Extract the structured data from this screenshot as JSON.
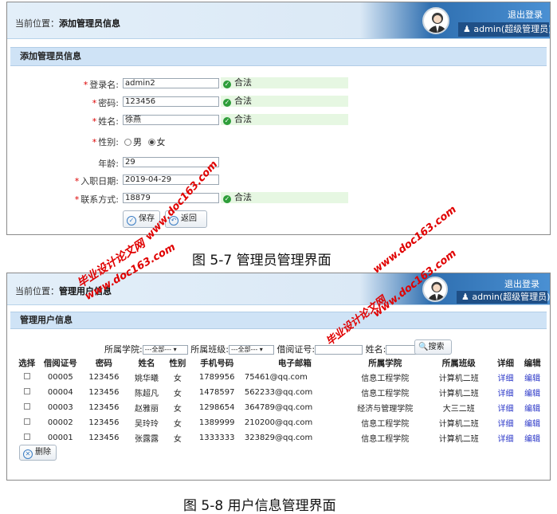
{
  "figure1": {
    "breadcrumb_prefix": "当前位置：",
    "breadcrumb_current": "添加管理员信息",
    "logout": "退出登录",
    "admin_label": "admin(超级管理员)",
    "section_title": "添加管理员信息",
    "fields": [
      {
        "label": "登录名:",
        "required": true,
        "value": "admin2",
        "status": "合法"
      },
      {
        "label": "密码:",
        "required": true,
        "value": "123456",
        "status": "合法"
      },
      {
        "label": "姓名:",
        "required": true,
        "value": "徐燕",
        "status": "合法"
      },
      {
        "label": "年龄:",
        "required": false,
        "value": "29",
        "status": ""
      },
      {
        "label": "入职日期:",
        "required": true,
        "value": "2019-04-29",
        "status": ""
      },
      {
        "label": "联系方式:",
        "required": true,
        "value": "18879",
        "status": "合法"
      }
    ],
    "gender": {
      "label": "性别:",
      "options": [
        "男",
        "女"
      ],
      "selected": "女"
    },
    "save_btn": "保存",
    "back_btn": "返回",
    "caption": "图 5-7 管理员管理界面"
  },
  "figure2": {
    "breadcrumb_prefix": "当前位置：",
    "breadcrumb_current": "管理用户信息",
    "logout": "退出登录",
    "admin_label": "admin(超级管理员)",
    "section_title": "管理用户信息",
    "filters": {
      "college_label": "所属学院:",
      "college_value": "---全部---",
      "class_label": "所属班级:",
      "class_value": "---全部---",
      "card_label": "借阅证号:",
      "name_label": "姓名:",
      "search_btn": "搜索"
    },
    "columns": [
      "选择",
      "借阅证号",
      "密码",
      "姓名",
      "性别",
      "手机号码",
      "电子邮箱",
      "所属学院",
      "所属班级",
      "详细",
      "编辑"
    ],
    "rows": [
      {
        "id": "00005",
        "pwd": "123456",
        "name": "姚华曦",
        "sex": "女",
        "phone": "1789956",
        "email": "75461@qq.com",
        "college": "信息工程学院",
        "cls": "计算机二班",
        "detail": "详细",
        "edit": "编辑"
      },
      {
        "id": "00004",
        "pwd": "123456",
        "name": "陈超凡",
        "sex": "女",
        "phone": "1478597",
        "email": "562233@qq.com",
        "college": "信息工程学院",
        "cls": "计算机二班",
        "detail": "详细",
        "edit": "编辑"
      },
      {
        "id": "00003",
        "pwd": "123456",
        "name": "赵雅丽",
        "sex": "女",
        "phone": "1298654",
        "email": "364789@qq.com",
        "college": "经济与管理学院",
        "cls": "大三二班",
        "detail": "详细",
        "edit": "编辑"
      },
      {
        "id": "00002",
        "pwd": "123456",
        "name": "吴玲玲",
        "sex": "女",
        "phone": "1389999",
        "email": "210200@qq.com",
        "college": "信息工程学院",
        "cls": "计算机二班",
        "detail": "详细",
        "edit": "编辑"
      },
      {
        "id": "00001",
        "pwd": "123456",
        "name": "张露露",
        "sex": "女",
        "phone": "1333333",
        "email": "323829@qq.com",
        "college": "信息工程学院",
        "cls": "计算机二班",
        "detail": "详细",
        "edit": "编辑"
      }
    ],
    "delete_btn": "删除",
    "caption": "图 5-8 用户信息管理界面"
  },
  "watermarks": {
    "cn": "毕业设计论文网",
    "url": "www.doc163.com"
  }
}
